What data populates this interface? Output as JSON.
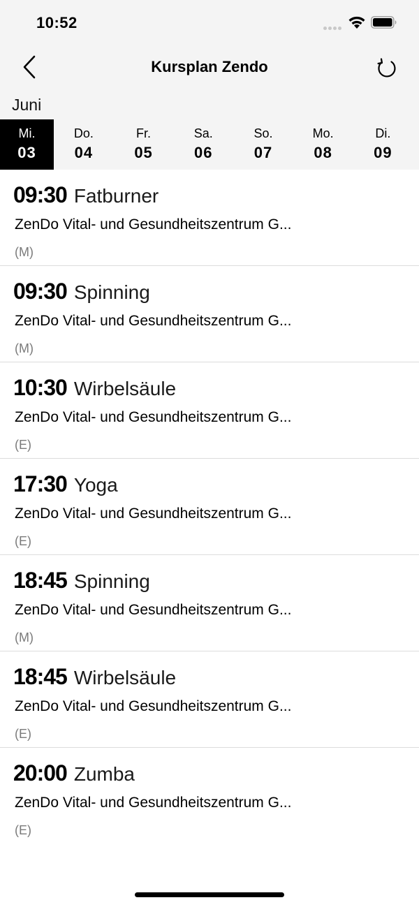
{
  "status_bar": {
    "time": "10:52"
  },
  "header": {
    "title": "Kursplan Zendo",
    "back_icon": "chevron-left-icon",
    "refresh_icon": "refresh-icon"
  },
  "month": "Juni",
  "days": [
    {
      "weekday": "Mi.",
      "date": "03",
      "selected": true
    },
    {
      "weekday": "Do.",
      "date": "04",
      "selected": false
    },
    {
      "weekday": "Fr.",
      "date": "05",
      "selected": false
    },
    {
      "weekday": "Sa.",
      "date": "06",
      "selected": false
    },
    {
      "weekday": "So.",
      "date": "07",
      "selected": false
    },
    {
      "weekday": "Mo.",
      "date": "08",
      "selected": false
    },
    {
      "weekday": "Di.",
      "date": "09",
      "selected": false
    }
  ],
  "courses": [
    {
      "time": "09:30",
      "name": "Fatburner",
      "location": "ZenDo Vital- und Gesundheitszentrum G...",
      "level": "(M)"
    },
    {
      "time": "09:30",
      "name": "Spinning",
      "location": "ZenDo Vital- und Gesundheitszentrum G...",
      "level": "(M)"
    },
    {
      "time": "10:30",
      "name": "Wirbelsäule",
      "location": "ZenDo Vital- und Gesundheitszentrum G...",
      "level": "(E)"
    },
    {
      "time": "17:30",
      "name": "Yoga",
      "location": "ZenDo Vital- und Gesundheitszentrum G...",
      "level": "(E)"
    },
    {
      "time": "18:45",
      "name": "Spinning",
      "location": "ZenDo Vital- und Gesundheitszentrum G...",
      "level": "(M)"
    },
    {
      "time": "18:45",
      "name": "Wirbelsäule",
      "location": "ZenDo Vital- und Gesundheitszentrum G...",
      "level": "(E)"
    },
    {
      "time": "20:00",
      "name": "Zumba",
      "location": "ZenDo Vital- und Gesundheitszentrum G...",
      "level": "(E)"
    }
  ],
  "colors": {
    "header_bg": "#f4f4f4",
    "selected_day_bg": "#000000",
    "level_text": "#7a7a7a",
    "divider": "#dcdcdc"
  }
}
